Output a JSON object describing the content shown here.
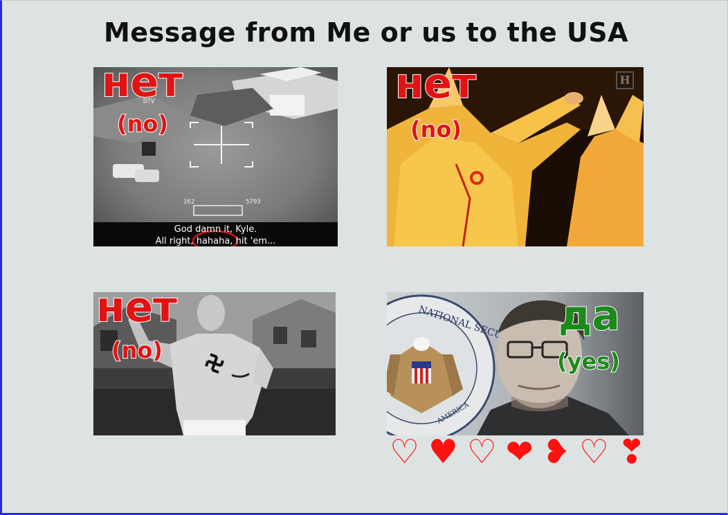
{
  "title": "Message from Me or us to the USA",
  "panels": [
    {
      "word": "нет",
      "translation": "(no)",
      "word_color": "#e11313",
      "subtitle_line1": "God damn it, Kyle.",
      "subtitle_line2": "All right, hahaha, hit 'em...",
      "hud_text": [
        "DTV",
        "162",
        "5793"
      ]
    },
    {
      "word": "нет",
      "translation": "(no)",
      "word_color": "#e11313",
      "corner_mark": "H"
    },
    {
      "word": "нет",
      "translation": "(no)",
      "word_color": "#e11313"
    },
    {
      "word": "да",
      "translation": "(yes)",
      "word_color": "#1b8a1b",
      "seal_text": "NATIONAL SECURITY AGENCY",
      "seal_text_bottom": "AMERICA"
    }
  ],
  "hearts": [
    "♡",
    "♥",
    "♡",
    "❤",
    "❥",
    "♡",
    "❣"
  ],
  "colors": {
    "background": "#dde3e3",
    "frame_border": "#2a2ad8",
    "no_red": "#e11313",
    "yes_green": "#1b8a1b",
    "heart_red": "#ff1111"
  }
}
